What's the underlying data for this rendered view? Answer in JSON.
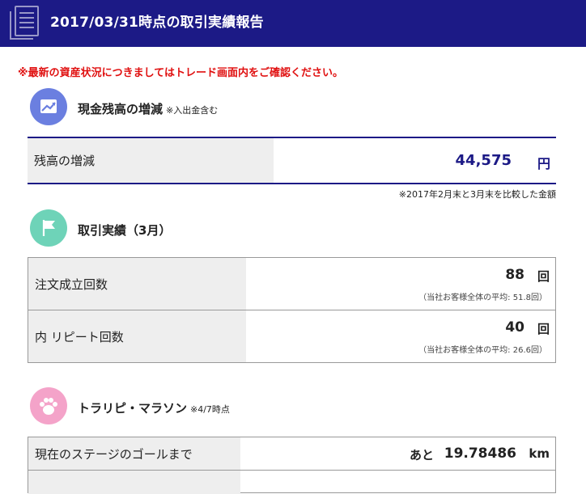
{
  "header": {
    "title": "2017/03/31時点の取引実績報告",
    "icon": "document-icon"
  },
  "notice": "※最新の資産状況につきましてはトレード画面内をご確認ください。",
  "cash": {
    "title": "現金残高の増減",
    "note": "※入出金含む",
    "label": "残高の増減",
    "value": "44,575",
    "unit": "円",
    "footnote": "※2017年2月末と3月末を比較した金額",
    "icon_color": "#6b7fe0"
  },
  "trades": {
    "title": "取引実績（3月）",
    "icon_color": "#6ed3b8",
    "rows": [
      {
        "label": "注文成立回数",
        "value": "88",
        "unit": "回",
        "avg": "（当社お客様全体の平均: 51.8回）"
      },
      {
        "label": "内 リピート回数",
        "value": "40",
        "unit": "回",
        "avg": "（当社お客様全体の平均: 26.6回）"
      }
    ]
  },
  "marathon": {
    "title": "トラリピ・マラソン",
    "note": "※4/7時点",
    "icon_color": "#f4a3c9",
    "row": {
      "label": "現在のステージのゴールまで",
      "prefix": "あと",
      "value": "19.78486",
      "unit": "km"
    }
  },
  "colors": {
    "header_bg": "#1c1a86",
    "accent": "#1c1a86",
    "notice": "#e01010"
  }
}
